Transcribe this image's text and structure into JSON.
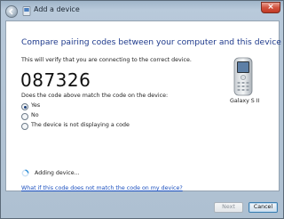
{
  "window": {
    "title": "Add a device",
    "close_glyph": "×"
  },
  "main": {
    "heading": "Compare pairing codes between your computer and this device",
    "subtext": "This will verify that you are connecting to the correct device.",
    "pairing_code": "087326",
    "question": "Does the code above match the code on the device:",
    "options": [
      {
        "label": "Yes",
        "selected": true
      },
      {
        "label": "No",
        "selected": false
      },
      {
        "label": "The device is not displaying a code",
        "selected": false
      }
    ],
    "device_name": "Galaxy S II",
    "progress_text": "Adding device...",
    "help_link": "What if this code does not match the code on my device?"
  },
  "footer": {
    "next_label": "Next",
    "cancel_label": "Cancel"
  },
  "colors": {
    "heading": "#1e3a8c",
    "link": "#1a4fbf",
    "chrome": "#b7c8d9",
    "close": "#c13a25"
  },
  "icons": [
    "back-arrow-icon",
    "bluetooth-device-icon",
    "phone-icon",
    "spinner-icon"
  ]
}
